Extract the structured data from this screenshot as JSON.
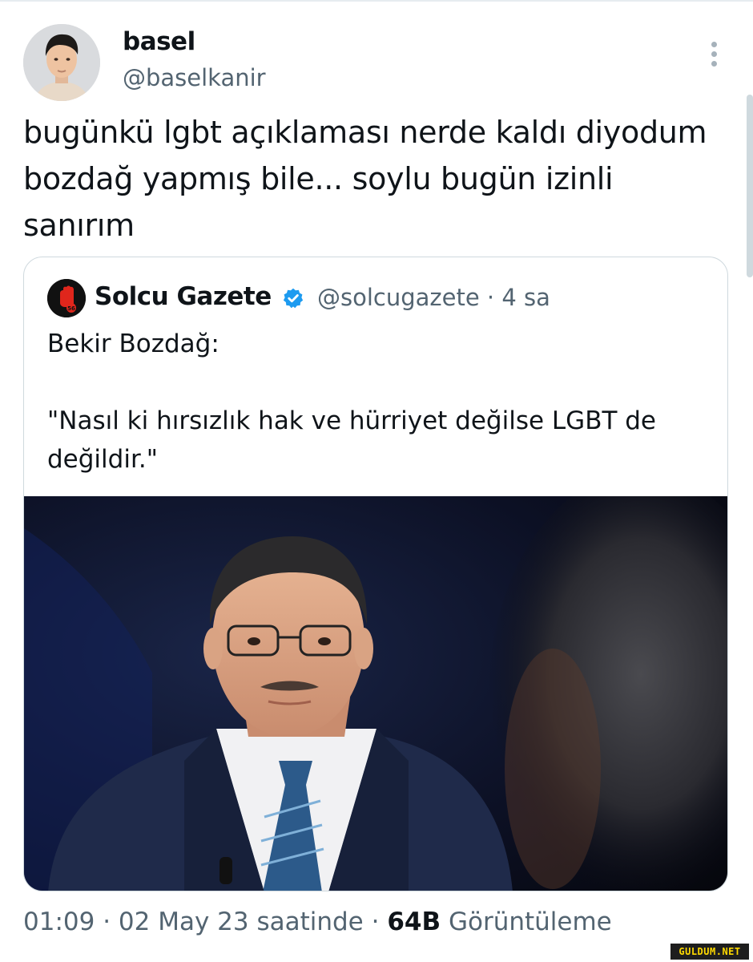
{
  "tweet": {
    "author_name": "basel",
    "author_handle": "@baselkanir",
    "text": "bugünkü lgbt açıklaması nerde kaldı diyodum bozdağ yapmış bile... soylu bugün izinli sanırım",
    "more_icon": "more-vertical-icon"
  },
  "quote": {
    "name": "Solcu Gazete",
    "verified_icon": "verified-badge-icon",
    "handle_time": "@solcugazete · 4 sa",
    "text": "Bekir Bozdağ:\n\n\"Nasıl ki hırsızlık hak ve hürriyet değilse LGBT de değildir.\"",
    "avatar_badge": "56"
  },
  "meta": {
    "time": "01:09",
    "sep1": " · ",
    "date": "02 May 23 saatinde",
    "sep2": " · ",
    "views_count": "64B",
    "views_label": " Görüntüleme"
  },
  "watermark": "GULDUM.NET",
  "colors": {
    "text": "#0f1419",
    "secondary": "#536471",
    "border": "#cfd9de",
    "verified": "#1d9bf0"
  }
}
